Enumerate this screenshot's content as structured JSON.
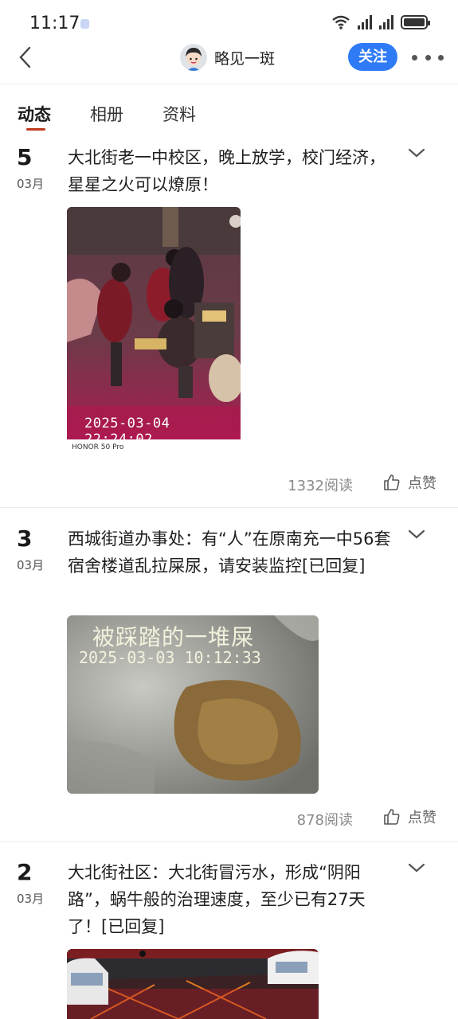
{
  "status": {
    "time": "11:17"
  },
  "header": {
    "nickname": "略见一斑",
    "follow_label": "关注"
  },
  "tabs": [
    {
      "label": "动态"
    },
    {
      "label": "相册"
    },
    {
      "label": "资料"
    }
  ],
  "posts": [
    {
      "day": "5",
      "month": "03月",
      "text": "大北街老一中校区，晚上放学，校门经济，星星之火可以燎原！",
      "image_timestamp": "2025-03-04  22:24:02",
      "image_device": "HONOR 50 Pro",
      "reads": "1332阅读",
      "like_label": "点赞"
    },
    {
      "day": "3",
      "month": "03月",
      "text": "西城街道办事处：有“人”在原南充一中56套宿舍楼道乱拉屎尿，请安装监控[已回复]",
      "image_title": "被踩踏的一堆屎",
      "image_timestamp": "2025-03-03  10:12:33",
      "reads": "878阅读",
      "like_label": "点赞"
    },
    {
      "day": "2",
      "month": "03月",
      "text": "大北街社区：大北街冒污水，形成“阴阳路”，蜗牛般的治理速度，至少已有27天了！[已回复]"
    }
  ],
  "colors": {
    "accent": "#2f7bf5",
    "tab_indicator": "#c0391b",
    "muted_text": "#8a8a8a"
  },
  "icons": [
    "back-arrow-icon",
    "wifi-icon",
    "signal-icon",
    "battery-icon",
    "more-dots-icon",
    "chevron-down-icon",
    "thumbs-up-icon"
  ]
}
